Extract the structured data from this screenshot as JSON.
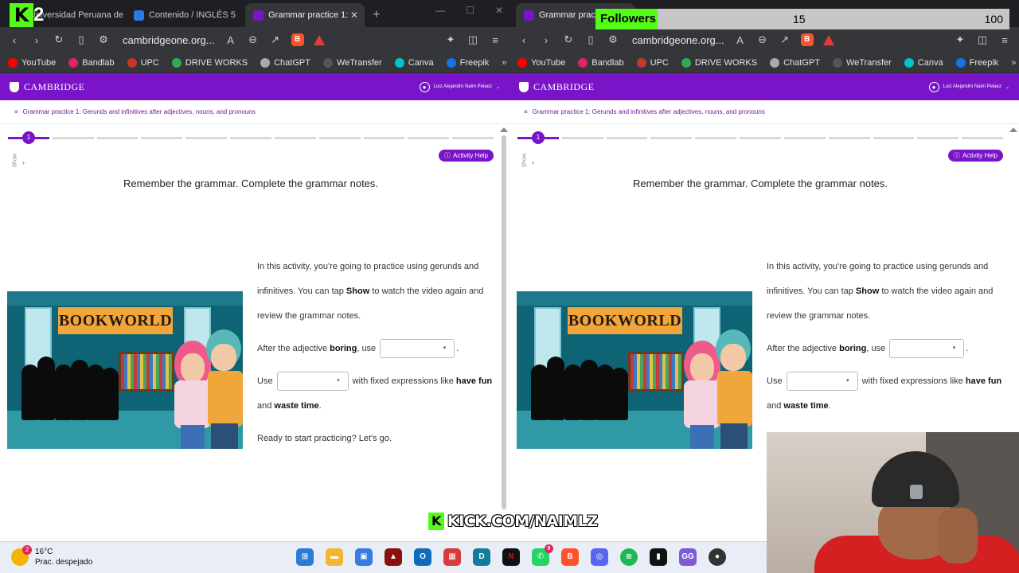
{
  "left_browser": {
    "tabs": [
      {
        "label": "Universidad Peruana de C",
        "active": false
      },
      {
        "label": "Contenido / INGLÉS 5",
        "active": false
      },
      {
        "label": "Grammar practice 1:",
        "active": true
      }
    ],
    "url": "cambridgeone.org...",
    "bookmarks": [
      "YouTube",
      "Bandlab",
      "UPC",
      "DRIVE WORKS",
      "ChatGPT",
      "WeTransfer",
      "Canva",
      "Freepik"
    ]
  },
  "right_browser": {
    "tabs": [
      {
        "label": "Grammar practic",
        "active": true
      }
    ],
    "url": "cambridgeone.org...",
    "bookmarks": [
      "YouTube",
      "Bandlab",
      "UPC",
      "DRIVE WORKS",
      "ChatGPT",
      "WeTransfer",
      "Canva",
      "Freepik"
    ]
  },
  "page": {
    "logo": "CAMBRIDGE",
    "user_name": "Luiz Alejandro Naim Pelaez",
    "breadcrumb": "Grammar practice 1: Gerunds and infinitives after adjectives, nouns, and pronouns",
    "progress_step": "1",
    "show_label": "Show",
    "activity_help": "Activity Help",
    "instruction": "Remember the grammar. Complete the grammar notes.",
    "scene_sign": "BOOKWORLD",
    "intro_1": "In this activity, you're going to practice using gerunds and infinitives. You can tap ",
    "intro_show": "Show",
    "intro_2": " to watch the video again and review the grammar notes.",
    "line1_a": "After the adjective ",
    "line1_bold": "boring",
    "line1_b": ", use",
    "line1_end": ".",
    "line2_a": "Use",
    "line2_b": " with fixed expressions like ",
    "line2_bold1": "have fun",
    "line2_c": " and ",
    "line2_bold2": "waste time",
    "line2_end": ".",
    "ready": "Ready to start practicing? Let's go."
  },
  "overlay": {
    "followers_label": "Followers",
    "followers_current": "15",
    "followers_goal": "100",
    "followers_progress": 0.15,
    "kick_url": "KICK.COM/NAIMLZ",
    "kick_logo": "2"
  },
  "taskbar": {
    "temperature": "16°C",
    "weather": "Prac. despejado",
    "weather_badge": "2",
    "whatsapp_badge": "9"
  },
  "colors": {
    "cambridge_purple": "#7a14c8",
    "kick_green": "#53fc18"
  }
}
